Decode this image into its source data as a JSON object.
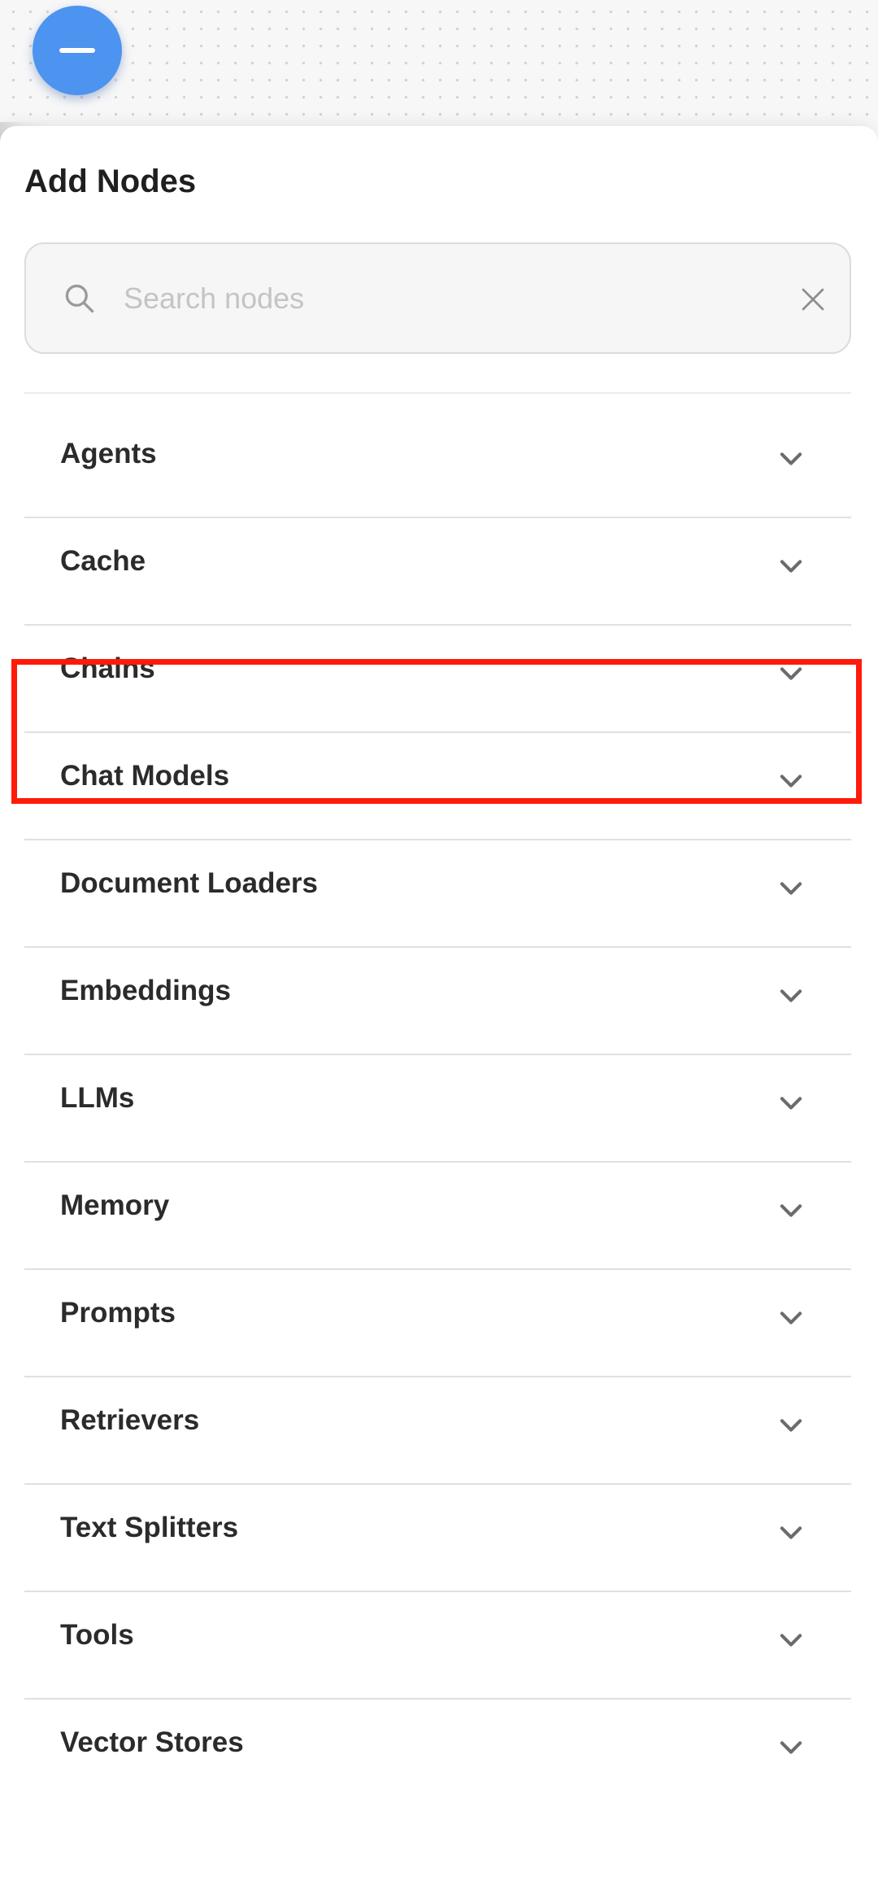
{
  "fab": {
    "icon": "minus-icon",
    "color": "#4d93f0"
  },
  "panel": {
    "title": "Add Nodes"
  },
  "search": {
    "placeholder": "Search nodes",
    "value": "",
    "search_icon": "search-icon",
    "clear_icon": "close-icon"
  },
  "categories": [
    {
      "label": "Agents",
      "icon": "chevron-down-icon"
    },
    {
      "label": "Cache",
      "icon": "chevron-down-icon"
    },
    {
      "label": "Chains",
      "icon": "chevron-down-icon",
      "highlighted": true
    },
    {
      "label": "Chat Models",
      "icon": "chevron-down-icon"
    },
    {
      "label": "Document Loaders",
      "icon": "chevron-down-icon"
    },
    {
      "label": "Embeddings",
      "icon": "chevron-down-icon"
    },
    {
      "label": "LLMs",
      "icon": "chevron-down-icon"
    },
    {
      "label": "Memory",
      "icon": "chevron-down-icon"
    },
    {
      "label": "Prompts",
      "icon": "chevron-down-icon"
    },
    {
      "label": "Retrievers",
      "icon": "chevron-down-icon"
    },
    {
      "label": "Text Splitters",
      "icon": "chevron-down-icon"
    },
    {
      "label": "Tools",
      "icon": "chevron-down-icon"
    },
    {
      "label": "Vector Stores",
      "icon": "chevron-down-icon"
    }
  ],
  "highlight": {
    "color": "#ff1a0a",
    "target": "Chains"
  }
}
